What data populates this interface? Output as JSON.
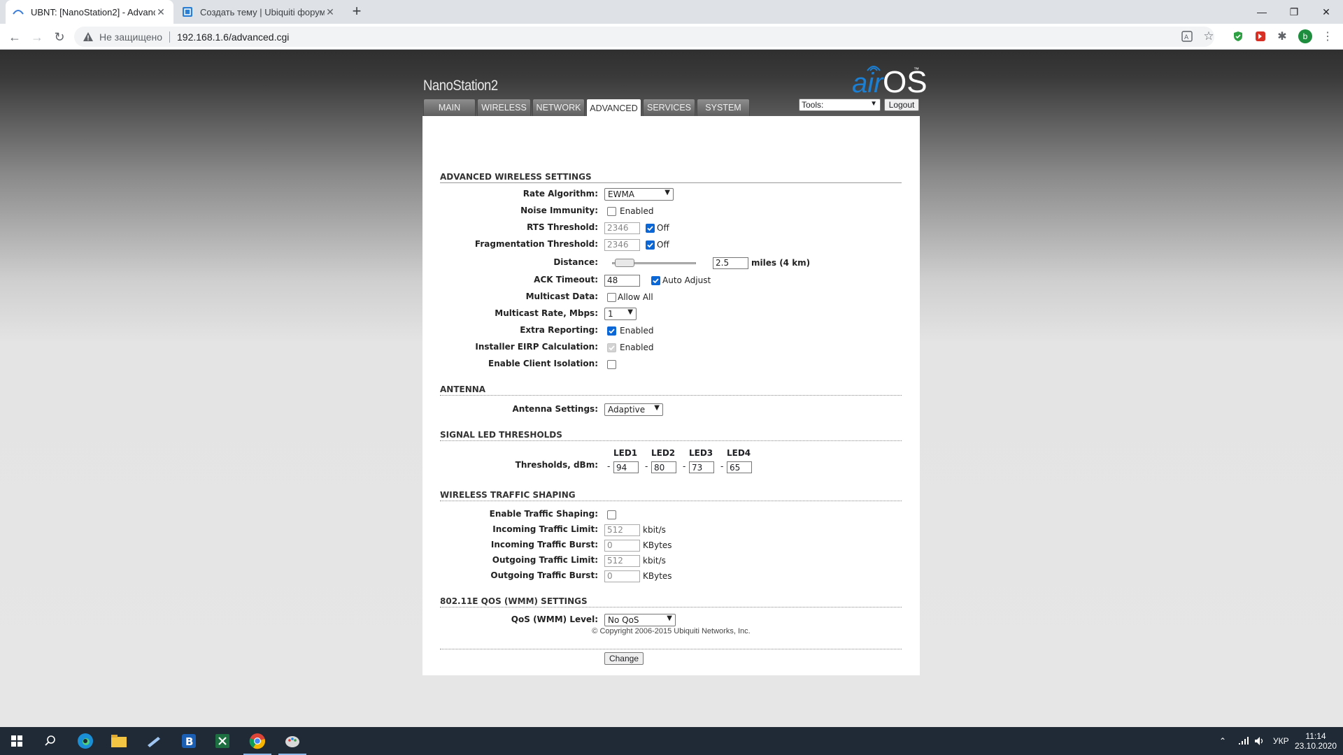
{
  "browser": {
    "tabs": [
      {
        "title": "UBNT: [NanoStation2] - Advance",
        "active": true
      },
      {
        "title": "Создать тему | Ubiquiti форум U",
        "active": false
      }
    ],
    "security_label": "Не защищено",
    "url": "192.168.1.6/advanced.cgi",
    "profile_initial": "b"
  },
  "page": {
    "brand": "NanoStation2",
    "logo_air": "air",
    "logo_os": "OS",
    "logo_tm": "™",
    "nav_tabs": [
      "MAIN",
      "WIRELESS",
      "NETWORK",
      "ADVANCED",
      "SERVICES",
      "SYSTEM"
    ],
    "active_tab": "ADVANCED",
    "tools_label": "Tools:",
    "logout_label": "Logout",
    "sections": {
      "advanced": "ADVANCED WIRELESS SETTINGS",
      "antenna": "ANTENNA",
      "led": "SIGNAL LED THRESHOLDS",
      "shaping": "WIRELESS TRAFFIC SHAPING",
      "qos": "802.11E QOS (WMM) SETTINGS"
    },
    "advanced": {
      "rate_algorithm": {
        "label": "Rate Algorithm:",
        "value": "EWMA"
      },
      "noise_immunity": {
        "label": "Noise Immunity:",
        "checked": false,
        "text": "Enabled"
      },
      "rts_threshold": {
        "label": "RTS Threshold:",
        "value": "2346",
        "off_checked": true,
        "off_text": "Off"
      },
      "frag_threshold": {
        "label": "Fragmentation Threshold:",
        "value": "2346",
        "off_checked": true,
        "off_text": "Off"
      },
      "distance": {
        "label": "Distance:",
        "value": "2.5",
        "slider_fraction": 0.04,
        "unit_text": "miles (4 km)"
      },
      "ack_timeout": {
        "label": "ACK Timeout:",
        "value": "48",
        "auto_checked": true,
        "auto_text": "Auto Adjust"
      },
      "multicast_data": {
        "label": "Multicast Data:",
        "checked": false,
        "text": "Allow All"
      },
      "multicast_rate": {
        "label": "Multicast Rate, Mbps:",
        "value": "1"
      },
      "extra_reporting": {
        "label": "Extra Reporting:",
        "checked": true,
        "text": "Enabled"
      },
      "installer_eirp": {
        "label": "Installer EIRP Calculation:",
        "checked": true,
        "disabled": true,
        "text": "Enabled"
      },
      "client_isolation": {
        "label": "Enable Client Isolation:",
        "checked": false
      }
    },
    "antenna": {
      "settings": {
        "label": "Antenna Settings:",
        "value": "Adaptive"
      }
    },
    "led": {
      "label": "Thresholds, dBm:",
      "headers": [
        "LED1",
        "LED2",
        "LED3",
        "LED4"
      ],
      "values": [
        "94",
        "80",
        "73",
        "65"
      ],
      "prefix": "-"
    },
    "shaping": {
      "enable": {
        "label": "Enable Traffic Shaping:",
        "checked": false
      },
      "in_limit": {
        "label": "Incoming Traffic Limit:",
        "value": "512",
        "unit": "kbit/s"
      },
      "in_burst": {
        "label": "Incoming Traffic Burst:",
        "value": "0",
        "unit": "KBytes"
      },
      "out_limit": {
        "label": "Outgoing Traffic Limit:",
        "value": "512",
        "unit": "kbit/s"
      },
      "out_burst": {
        "label": "Outgoing Traffic Burst:",
        "value": "0",
        "unit": "KBytes"
      }
    },
    "qos": {
      "level": {
        "label": "QoS (WMM) Level:",
        "value": "No QoS"
      }
    },
    "change_label": "Change",
    "copyright": "© Copyright 2006-2015 Ubiquiti Networks, Inc."
  },
  "taskbar": {
    "language": "УКР",
    "time": "11:14",
    "date": "23.10.2020"
  }
}
